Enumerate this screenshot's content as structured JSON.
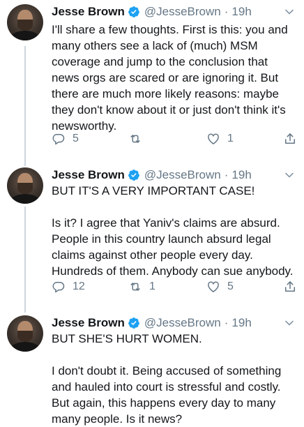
{
  "tweets": [
    {
      "author_name": "Jesse Brown",
      "handle": "@JesseBrown",
      "separator": "·",
      "time": "19h",
      "text": "I'll share a few thoughts. First is this: you and many others see a lack of (much) MSM coverage and jump to the conclusion that news orgs are scared or are ignoring it. But there are much more likely reasons: maybe they don't know about it or just don't think it's newsworthy.",
      "replies": "5",
      "retweets": "",
      "likes": "1"
    },
    {
      "author_name": "Jesse Brown",
      "handle": "@JesseBrown",
      "separator": "·",
      "time": "19h",
      "text": "BUT IT'S A VERY IMPORTANT CASE!\n\nIs it? I agree that Yaniv's claims are absurd. People in this country launch absurd legal claims against other people every day. Hundreds of them. Anybody can sue anybody.",
      "replies": "12",
      "retweets": "1",
      "likes": "5"
    },
    {
      "author_name": "Jesse Brown",
      "handle": "@JesseBrown",
      "separator": "·",
      "time": "19h",
      "text": "BUT SHE'S HURT WOMEN.\n\nI don't doubt it. Being accused of something and hauled into court is stressful and costly. But again, this happens every day to many many people. Is it news?"
    }
  ],
  "icons": {
    "verified": "verified-badge-icon",
    "caret": "chevron-down-icon",
    "reply": "reply-icon",
    "retweet": "retweet-icon",
    "like": "heart-icon",
    "share": "share-icon"
  },
  "colors": {
    "verified_blue": "#1da1f2",
    "muted_gray": "#657786",
    "text": "#14171a",
    "thread_line": "#ccd6dd"
  }
}
